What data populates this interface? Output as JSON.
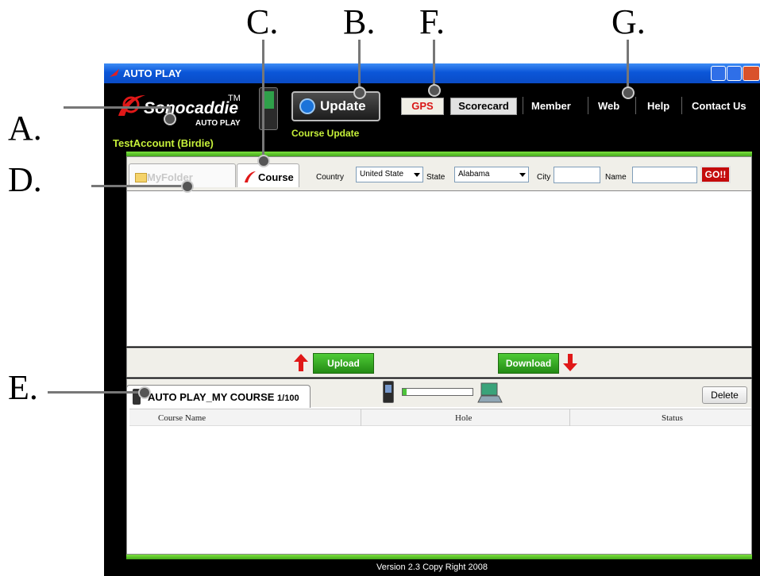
{
  "callouts": {
    "a": "A.",
    "b": "B.",
    "c": "C.",
    "d": "D.",
    "e": "E.",
    "f": "F.",
    "g": "G."
  },
  "window": {
    "title": "AUTO PLAY"
  },
  "header": {
    "logo_text": "Sonocaddie",
    "logo_tm": "TM",
    "logo_sub": "AUTO PLAY",
    "account": "TestAccount (Birdie)",
    "update_button": "Update",
    "update_sub": "Course Update",
    "nav": {
      "gps": "GPS",
      "scorecard": "Scorecard",
      "member": "Member",
      "web": "Web",
      "help": "Help",
      "contact": "Contact Us"
    }
  },
  "search": {
    "tab_myfolder": "MyFolder",
    "tab_course": "Course",
    "country_label": "Country",
    "country_value": "United State",
    "state_label": "State",
    "state_value": "Alabama",
    "city_label": "City",
    "name_label": "Name",
    "go_button": "GO!!"
  },
  "transfer": {
    "upload": "Upload",
    "download": "Download",
    "progress": 0.06
  },
  "device_panel": {
    "tab_label": "AUTO PLAY_MY COURSE",
    "count": "1/100",
    "delete_button": "Delete",
    "columns": [
      "Course Name",
      "Hole",
      "Status"
    ]
  },
  "footer": {
    "version": "Version 2.3 Copy Right 2008"
  },
  "colors": {
    "accent_green": "#c6f03a",
    "brand_red": "#d91616",
    "title_blue": "#0b56d8"
  }
}
